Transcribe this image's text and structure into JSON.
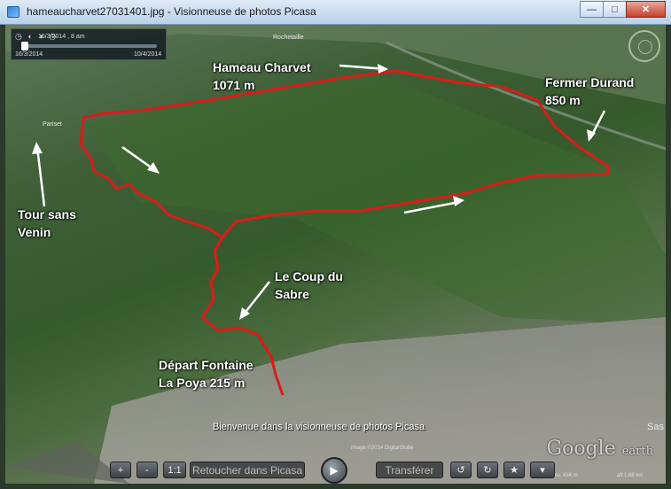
{
  "window": {
    "title": "hameaucharvet27031401.jpg - Visionneuse de photos Picasa",
    "controls": {
      "minimize": "—",
      "maximize": "□",
      "close": "✕"
    }
  },
  "photo": {
    "labels": {
      "hameau": "Hameau Charvet\n1071 m",
      "fermer": "Fermer Durand\n850 m",
      "tour": "Tour sans\nVenin",
      "coup": "Le Coup du\nSabre",
      "depart": "Départ Fontaine\nLa Poya 215 m"
    },
    "timeslider": {
      "current": "16/3/2014 , 8 am",
      "start": "16/3/2014",
      "end": "10/4/2014"
    },
    "place_names": {
      "pariset": "Pariset",
      "rochetaille": "Rochetaille",
      "sassenage": "Sas"
    },
    "watermark": {
      "google": "Google",
      "earth": "earth"
    },
    "status": {
      "image_date": "Image ©2014 DigitalGlobe",
      "elev": "elev. 434 m",
      "eye": "alt 1.68 km"
    }
  },
  "picasa": {
    "welcome": "Bienvenue dans la visionneuse de photos Picasa",
    "toolbar": {
      "plus": "+",
      "minus": "-",
      "ratio": "1:1",
      "retouch": "Retoucher dans Picasa",
      "play": "▶",
      "transfer": "Transférer",
      "rotate_left": "↺",
      "rotate_right": "↻",
      "star": "★",
      "more": "▾"
    }
  },
  "colors": {
    "route": "#dd1a1a",
    "titlebar": "#c7daee",
    "label_text": "#ffffff"
  }
}
